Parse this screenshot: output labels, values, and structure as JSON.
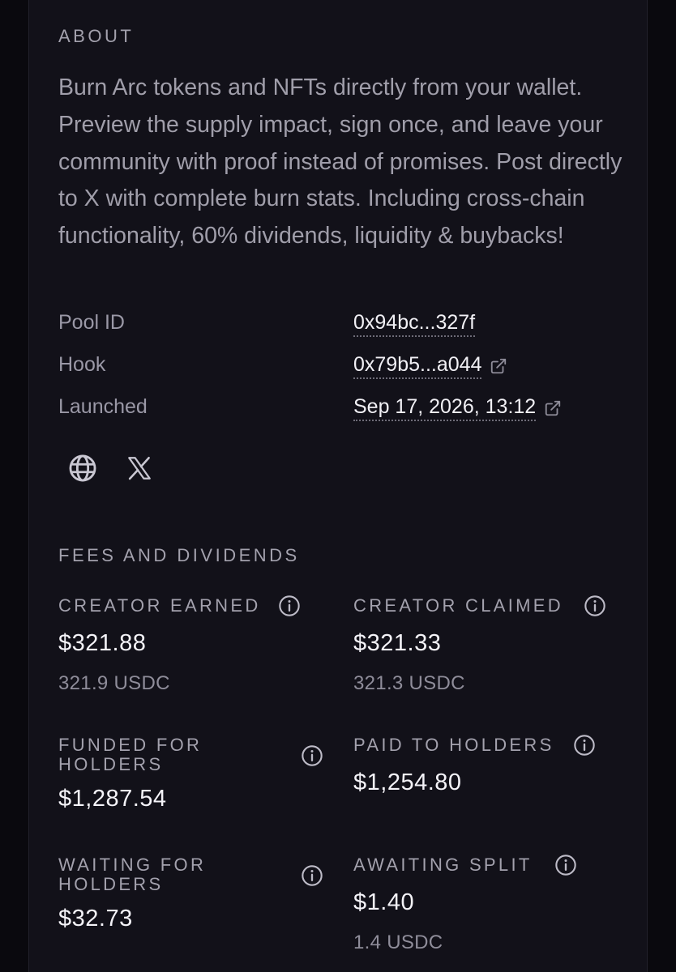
{
  "about": {
    "heading": "ABOUT",
    "description": "Burn Arc tokens and NFTs directly from your wallet. Preview the supply impact, sign once, and leave your community with proof instead of promises. Post directly to X with complete burn stats. Including cross-chain functionality, 60% dividends, liquidity & buybacks!"
  },
  "details": [
    {
      "label": "Pool ID",
      "value": "0x94bc...327f",
      "external_link": false
    },
    {
      "label": "Hook",
      "value": "0x79b5...a044",
      "external_link": true
    },
    {
      "label": "Launched",
      "value": "Sep 17, 2026, 13:12",
      "external_link": true
    }
  ],
  "socials": [
    {
      "icon": "globe-icon"
    },
    {
      "icon": "x-logo-icon"
    }
  ],
  "fees": {
    "heading": "FEES AND DIVIDENDS",
    "stats": [
      {
        "label": "CREATOR EARNED",
        "value": "$321.88",
        "sub": "321.9 USDC"
      },
      {
        "label": "CREATOR CLAIMED",
        "value": "$321.33",
        "sub": "321.3 USDC"
      },
      {
        "label": "FUNDED FOR HOLDERS",
        "label_line1": "FUNDED FOR",
        "label_line2": "HOLDERS",
        "value": "$1,287.54"
      },
      {
        "label": "PAID TO HOLDERS",
        "value": "$1,254.80"
      },
      {
        "label": "WAITING FOR HOLDERS",
        "label_line1": "WAITING FOR",
        "label_line2": "HOLDERS",
        "value": "$32.73"
      },
      {
        "label": "AWAITING SPLIT",
        "value": "$1.40",
        "sub": "1.4 USDC"
      }
    ]
  },
  "colors": {
    "background": "#0a090e",
    "panel": "#121119",
    "label": "#a3a1ad",
    "value": "#f4f3f8"
  }
}
